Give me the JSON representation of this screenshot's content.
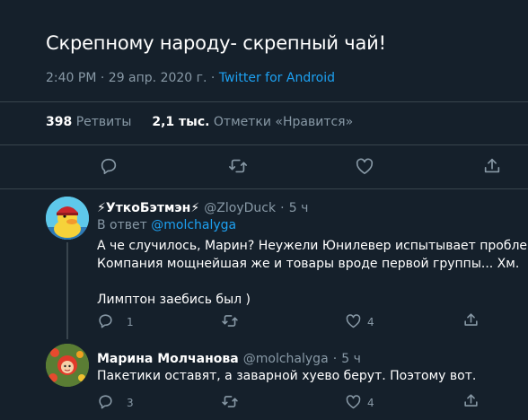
{
  "top_partial": "",
  "main_tweet": {
    "text": "Скрепному народу- скрепный чай!",
    "time": "2:40 PM",
    "sep1": "·",
    "date": "29 апр. 2020 г.",
    "sep2": "·",
    "source": "Twitter for Android",
    "retweets_count": "398",
    "retweets_label": "Ретвиты",
    "likes_count": "2,1 тыс.",
    "likes_label": "Отметки «Нравится»",
    "actions": [
      "reply-icon",
      "retweet-icon",
      "like-icon",
      "share-icon"
    ]
  },
  "replies": [
    {
      "name": "⚡УткоБэтмэн⚡",
      "handle": "@ZloyDuck",
      "sep": "·",
      "time": "5 ч",
      "in_reply_prefix": "В ответ",
      "in_reply_handle": "@molchalyga",
      "lines": [
        "А че случилось, Марин? Неужели Юнилевер испытывает проблемы?",
        "Компания мощнейшая же и товары вроде первой группы... Хм.",
        "",
        "Лимптон заебись был )"
      ],
      "reply_count": "1",
      "retweet_count": "",
      "like_count": "4"
    },
    {
      "name": "Марина Молчанова",
      "handle": "@molchalyga",
      "sep": "·",
      "time": "5 ч",
      "lines": [
        "Пакетики оставят, а заварной хуево берут. Поэтому вот."
      ],
      "reply_count": "3",
      "retweet_count": "",
      "like_count": "4"
    }
  ],
  "colors": {
    "background": "#15202b",
    "muted": "#8899a6",
    "accent": "#1da1f2",
    "divider": "#38444d"
  }
}
